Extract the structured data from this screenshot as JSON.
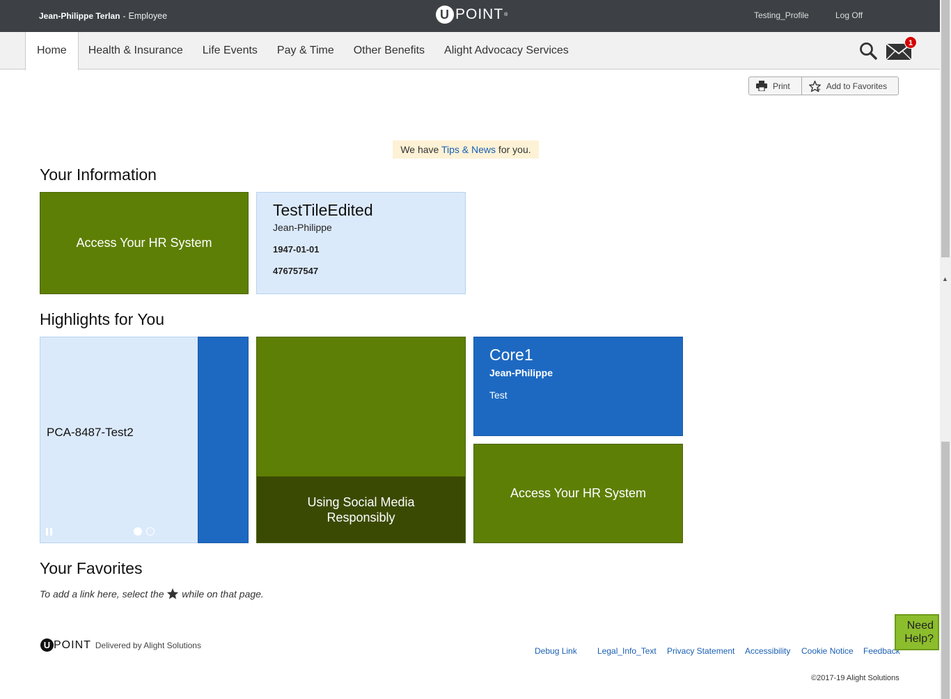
{
  "header": {
    "user_name": "Jean-Philippe Terlan",
    "separator": "-",
    "role": "Employee",
    "logo_text": "POINT",
    "logo_tm": "®",
    "profile_link": "Testing_Profile",
    "logoff_link": "Log Off"
  },
  "nav": {
    "items": [
      {
        "label": "Home"
      },
      {
        "label": "Health & Insurance"
      },
      {
        "label": "Life Events"
      },
      {
        "label": "Pay & Time"
      },
      {
        "label": "Other Benefits"
      },
      {
        "label": "Alight Advocacy Services"
      }
    ],
    "mail_count": "1"
  },
  "toolbar": {
    "print": "Print",
    "add_fav": "Add to Favorites"
  },
  "tips": {
    "pre": "We have ",
    "link": "Tips & News",
    "post": " for you."
  },
  "your_information": {
    "title": "Your Information",
    "hr_tile": "Access Your HR System",
    "test_tile": {
      "title": "TestTileEdited",
      "name": "Jean-Philippe",
      "date": "1947-01-01",
      "number": "476757547"
    }
  },
  "highlights": {
    "title": "Highlights for You",
    "carousel_text": "PCA-8487-Test2",
    "social_tile": "Using Social Media Responsibly",
    "core_tile": {
      "title": "Core1",
      "name": "Jean-Philippe",
      "text": "Test"
    },
    "hr_tile": "Access Your HR System"
  },
  "favorites": {
    "title": "Your Favorites",
    "text_pre": "To add a ",
    "text_link": "link here",
    "text_mid": ", select the",
    "text_post": "while on that page."
  },
  "footer": {
    "delivered": "Delivered by Alight Solutions",
    "links": [
      "Debug Link",
      "Legal_Info_Text",
      "Privacy Statement",
      "Accessibility",
      "Cookie Notice",
      "Feedback"
    ],
    "copyright": "©2017-19 Alight Solutions"
  },
  "help": {
    "line1": "Need",
    "line2": "Help?"
  }
}
